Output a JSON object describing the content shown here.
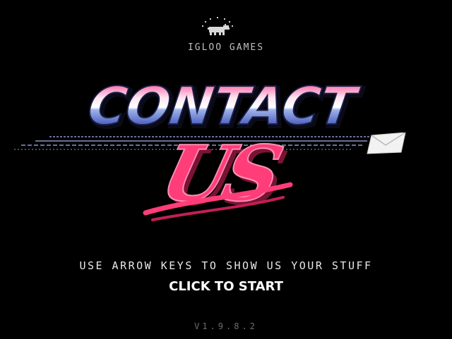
{
  "publisher": {
    "name": "IGLOO GAMES"
  },
  "title": {
    "line1": "CONTACT",
    "line2": "US"
  },
  "instructions": "USE ARROW KEYS TO SHOW US YOUR STUFF",
  "start_prompt": "CLICK TO START",
  "version": "V1.9.8.2",
  "colors": {
    "background": "#000000",
    "title_pink": "#ff6fa8",
    "title_blue": "#4a5db0",
    "brush_pink": "#ff3d78",
    "text": "#e8e8e8"
  },
  "icons": [
    "polar-bear-icon",
    "envelope-icon"
  ]
}
